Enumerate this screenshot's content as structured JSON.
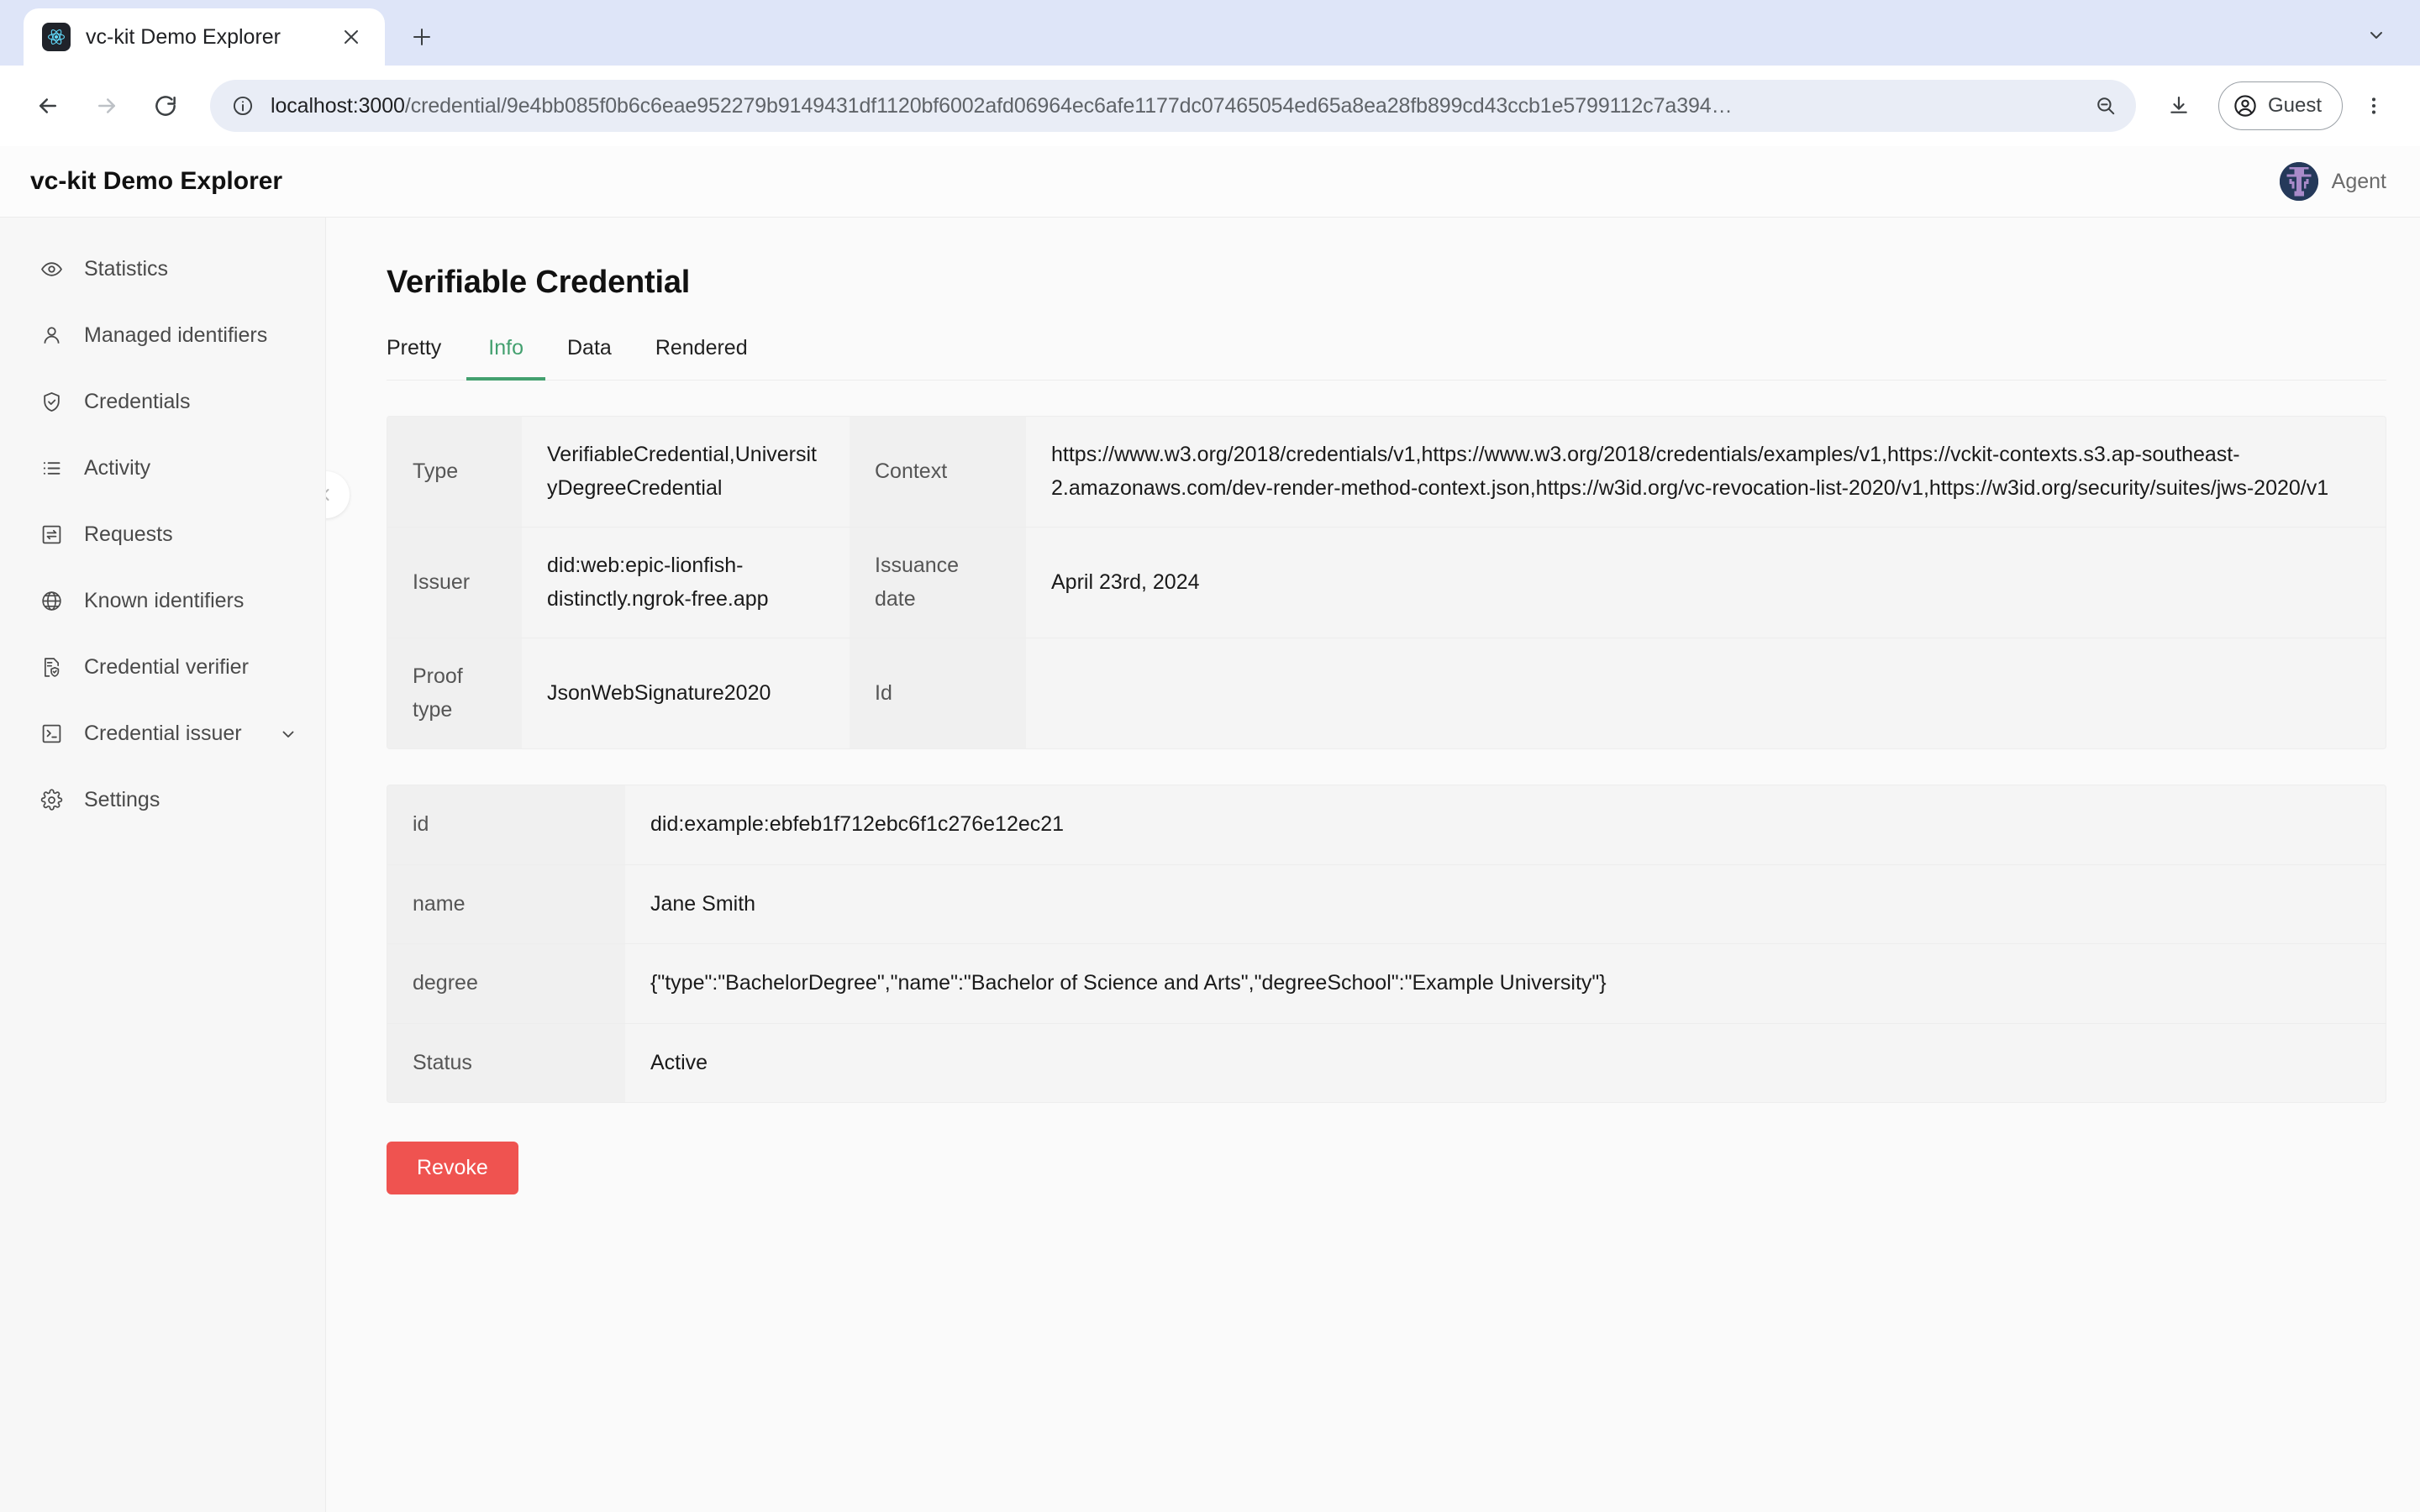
{
  "browser": {
    "tab": {
      "title": "vc-kit Demo Explorer",
      "favicon": "react-logo-icon",
      "close_label": "×"
    },
    "new_tab_label": "+",
    "toolbar": {
      "back": "back-arrow-icon",
      "forward": "forward-arrow-icon",
      "reload": "reload-icon",
      "site_info": "info-circle-icon",
      "url_scheme_host": "localhost:3000",
      "url_path": "/credential/9e4bb085f0b6c6eae952279b9149431df1120bf6002afd06964ec6afe1177dc07465054ed65a8ea28fb899cd43ccb1e5799112c7a394…",
      "url_full": "localhost:3000/credential/9e4bb085f0b6c6eae952279b9149431df1120bf6002afd06964ec6afe1177dc07465054ed65a8ea28fb899cd43ccb1e5799112c7a394…",
      "zoom_out": "zoom-out-icon",
      "download": "download-icon",
      "profile_label": "Guest",
      "menu": "kebab-menu-icon"
    }
  },
  "app": {
    "title": "vc-kit Demo Explorer",
    "user": {
      "name": "Agent",
      "avatar": "pixel-avatar"
    }
  },
  "sidebar": {
    "items": [
      {
        "label": "Statistics",
        "icon": "eye-icon",
        "expandable": false
      },
      {
        "label": "Managed identifiers",
        "icon": "person-icon",
        "expandable": false
      },
      {
        "label": "Credentials",
        "icon": "shield-check-icon",
        "expandable": false
      },
      {
        "label": "Activity",
        "icon": "list-icon",
        "expandable": false
      },
      {
        "label": "Requests",
        "icon": "exchange-box-icon",
        "expandable": false
      },
      {
        "label": "Known identifiers",
        "icon": "globe-icon",
        "expandable": false
      },
      {
        "label": "Credential verifier",
        "icon": "document-shield-icon",
        "expandable": false
      },
      {
        "label": "Credential issuer",
        "icon": "terminal-box-icon",
        "expandable": true
      },
      {
        "label": "Settings",
        "icon": "gear-icon",
        "expandable": false
      }
    ]
  },
  "main": {
    "collapse_button": "chevron-left-icon",
    "page_title": "Verifiable Credential",
    "tabs": [
      {
        "label": "Pretty",
        "active": false
      },
      {
        "label": "Info",
        "active": true
      },
      {
        "label": "Data",
        "active": false
      },
      {
        "label": "Rendered",
        "active": false
      }
    ],
    "info_table": {
      "rows": [
        {
          "label1": "Type",
          "value1": "VerifiableCredential,UniversityDegreeCredential",
          "label2": "Context",
          "value2": "https://www.w3.org/2018/credentials/v1,https://www.w3.org/2018/credentials/examples/v1,https://vckit-contexts.s3.ap-southeast-2.amazonaws.com/dev-render-method-context.json,https://w3id.org/vc-revocation-list-2020/v1,https://w3id.org/security/suites/jws-2020/v1"
        },
        {
          "label1": "Issuer",
          "value1": "did:web:epic-lionfish-distinctly.ngrok-free.app",
          "label2": "Issuance date",
          "value2": "April 23rd, 2024"
        },
        {
          "label1": "Proof type",
          "value1": "JsonWebSignature2020",
          "label2": "Id",
          "value2": ""
        }
      ]
    },
    "subject_table": {
      "rows": [
        {
          "label": "id",
          "value": "did:example:ebfeb1f712ebc6f1c276e12ec21"
        },
        {
          "label": "name",
          "value": "Jane Smith"
        },
        {
          "label": "degree",
          "value": "{\"type\":\"BachelorDegree\",\"name\":\"Bachelor of Science and Arts\",\"degreeSchool\":\"Example University\"}"
        },
        {
          "label": "Status",
          "value": "Active"
        }
      ]
    },
    "revoke_button": "Revoke"
  },
  "colors": {
    "accent_green": "#43a06f",
    "danger_red": "#ef5350",
    "sidebar_bg": "#f7f7f7",
    "content_bg": "#fafafa",
    "tabstrip_bg": "#dee5f8"
  }
}
